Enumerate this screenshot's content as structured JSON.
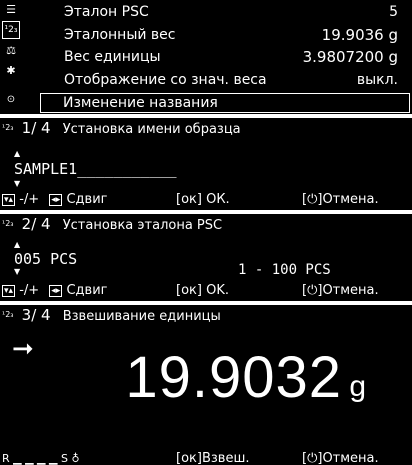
{
  "panel1": {
    "sidebar_icons": [
      "menu-icon",
      "sample-icon",
      "scale-icon",
      "gear-icon",
      "info-icon"
    ],
    "rows": [
      {
        "label": "Эталон PSC",
        "value": "5"
      },
      {
        "label": "Эталонный вес",
        "value": "19.9036 g"
      },
      {
        "label": "Вес единицы",
        "value": "3.9807200 g"
      },
      {
        "label": "Отображение со знач. веса",
        "value": "выкл."
      }
    ],
    "selected_row": "Изменение названия"
  },
  "panel2": {
    "step": "1/ 4",
    "title": "Установка имени образца",
    "entry": "SAMPLE1",
    "footer": {
      "left": "-/+",
      "left_label": "Сдвиг",
      "ok": "ОК.",
      "cancel": "Отмена."
    }
  },
  "panel3": {
    "step": "2/ 4",
    "title": "Установка эталона PSC",
    "entry": "005 PCS",
    "range": "1 - 100 PCS",
    "footer": {
      "left": "-/+",
      "left_label": "Сдвиг",
      "ok": "OK.",
      "cancel": "Отмена."
    }
  },
  "panel4": {
    "step": "3/ 4",
    "title": "Взвешивание единицы",
    "reading": "19.9032",
    "unit": "g",
    "footer": {
      "ok": "Взвеш.",
      "cancel": "Отмена."
    }
  }
}
